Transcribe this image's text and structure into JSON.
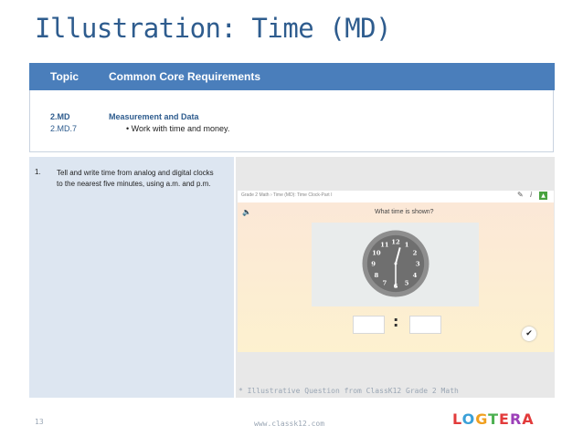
{
  "slide": {
    "title": "Illustration: Time (MD)",
    "page_number": "13",
    "footer_url": "www.classk12.com",
    "logo_text": "LOGTERA",
    "caption": "* Illustrative Question from ClassK12 Grade 2 Math"
  },
  "table": {
    "header": {
      "topic": "Topic",
      "requirements": "Common Core Requirements"
    },
    "row": {
      "code": "2.MD",
      "subcode": "2.MD.7",
      "domain": "Measurement and Data",
      "bullet": "•  Work with time and money."
    },
    "item": {
      "number": "1.",
      "text": "Tell and write time from analog and digital clocks to the nearest five minutes, using a.m. and p.m."
    }
  },
  "app": {
    "breadcrumb": "Grade 2 Math › Time (MD): Time Clock-Part I",
    "question": "What time is shown?",
    "clock_numbers": [
      "12",
      "1",
      "2",
      "3",
      "4",
      "5",
      "6",
      "7",
      "8",
      "9",
      "10",
      "11"
    ],
    "clock_time": {
      "hour": 12,
      "minute": 30
    },
    "colon": ":",
    "hours_value": "",
    "minutes_value": "",
    "check_label": "✔",
    "speaker_icon": "🔈",
    "pencil_icon": "✎",
    "info_icon": "i",
    "expand_icon": "▲"
  },
  "colors": {
    "title": "#2e5c8e",
    "header_bg": "#4a7ebb",
    "left_cell_bg": "#dde6f1",
    "right_cell_bg": "#e8e8e8"
  }
}
